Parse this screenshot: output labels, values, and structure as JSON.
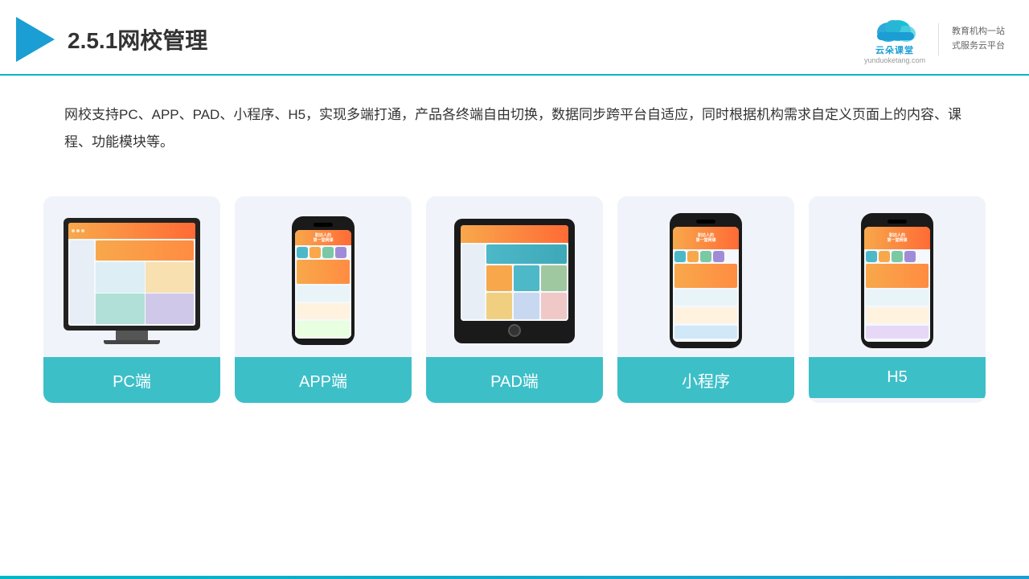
{
  "header": {
    "title": "2.5.1网校管理",
    "brand_name": "云朵课堂",
    "brand_url": "yunduoketang.com",
    "brand_tagline_1": "教育机构一站",
    "brand_tagline_2": "式服务云平台"
  },
  "description": {
    "text": "网校支持PC、APP、PAD、小程序、H5，实现多端打通，产品各终端自由切换，数据同步跨平台自适应，同时根据机构需求自定义页面上的内容、课程、功能模块等。"
  },
  "cards": [
    {
      "id": "pc",
      "label": "PC端"
    },
    {
      "id": "app",
      "label": "APP端"
    },
    {
      "id": "pad",
      "label": "PAD端"
    },
    {
      "id": "miniprogram",
      "label": "小程序"
    },
    {
      "id": "h5",
      "label": "H5"
    }
  ]
}
